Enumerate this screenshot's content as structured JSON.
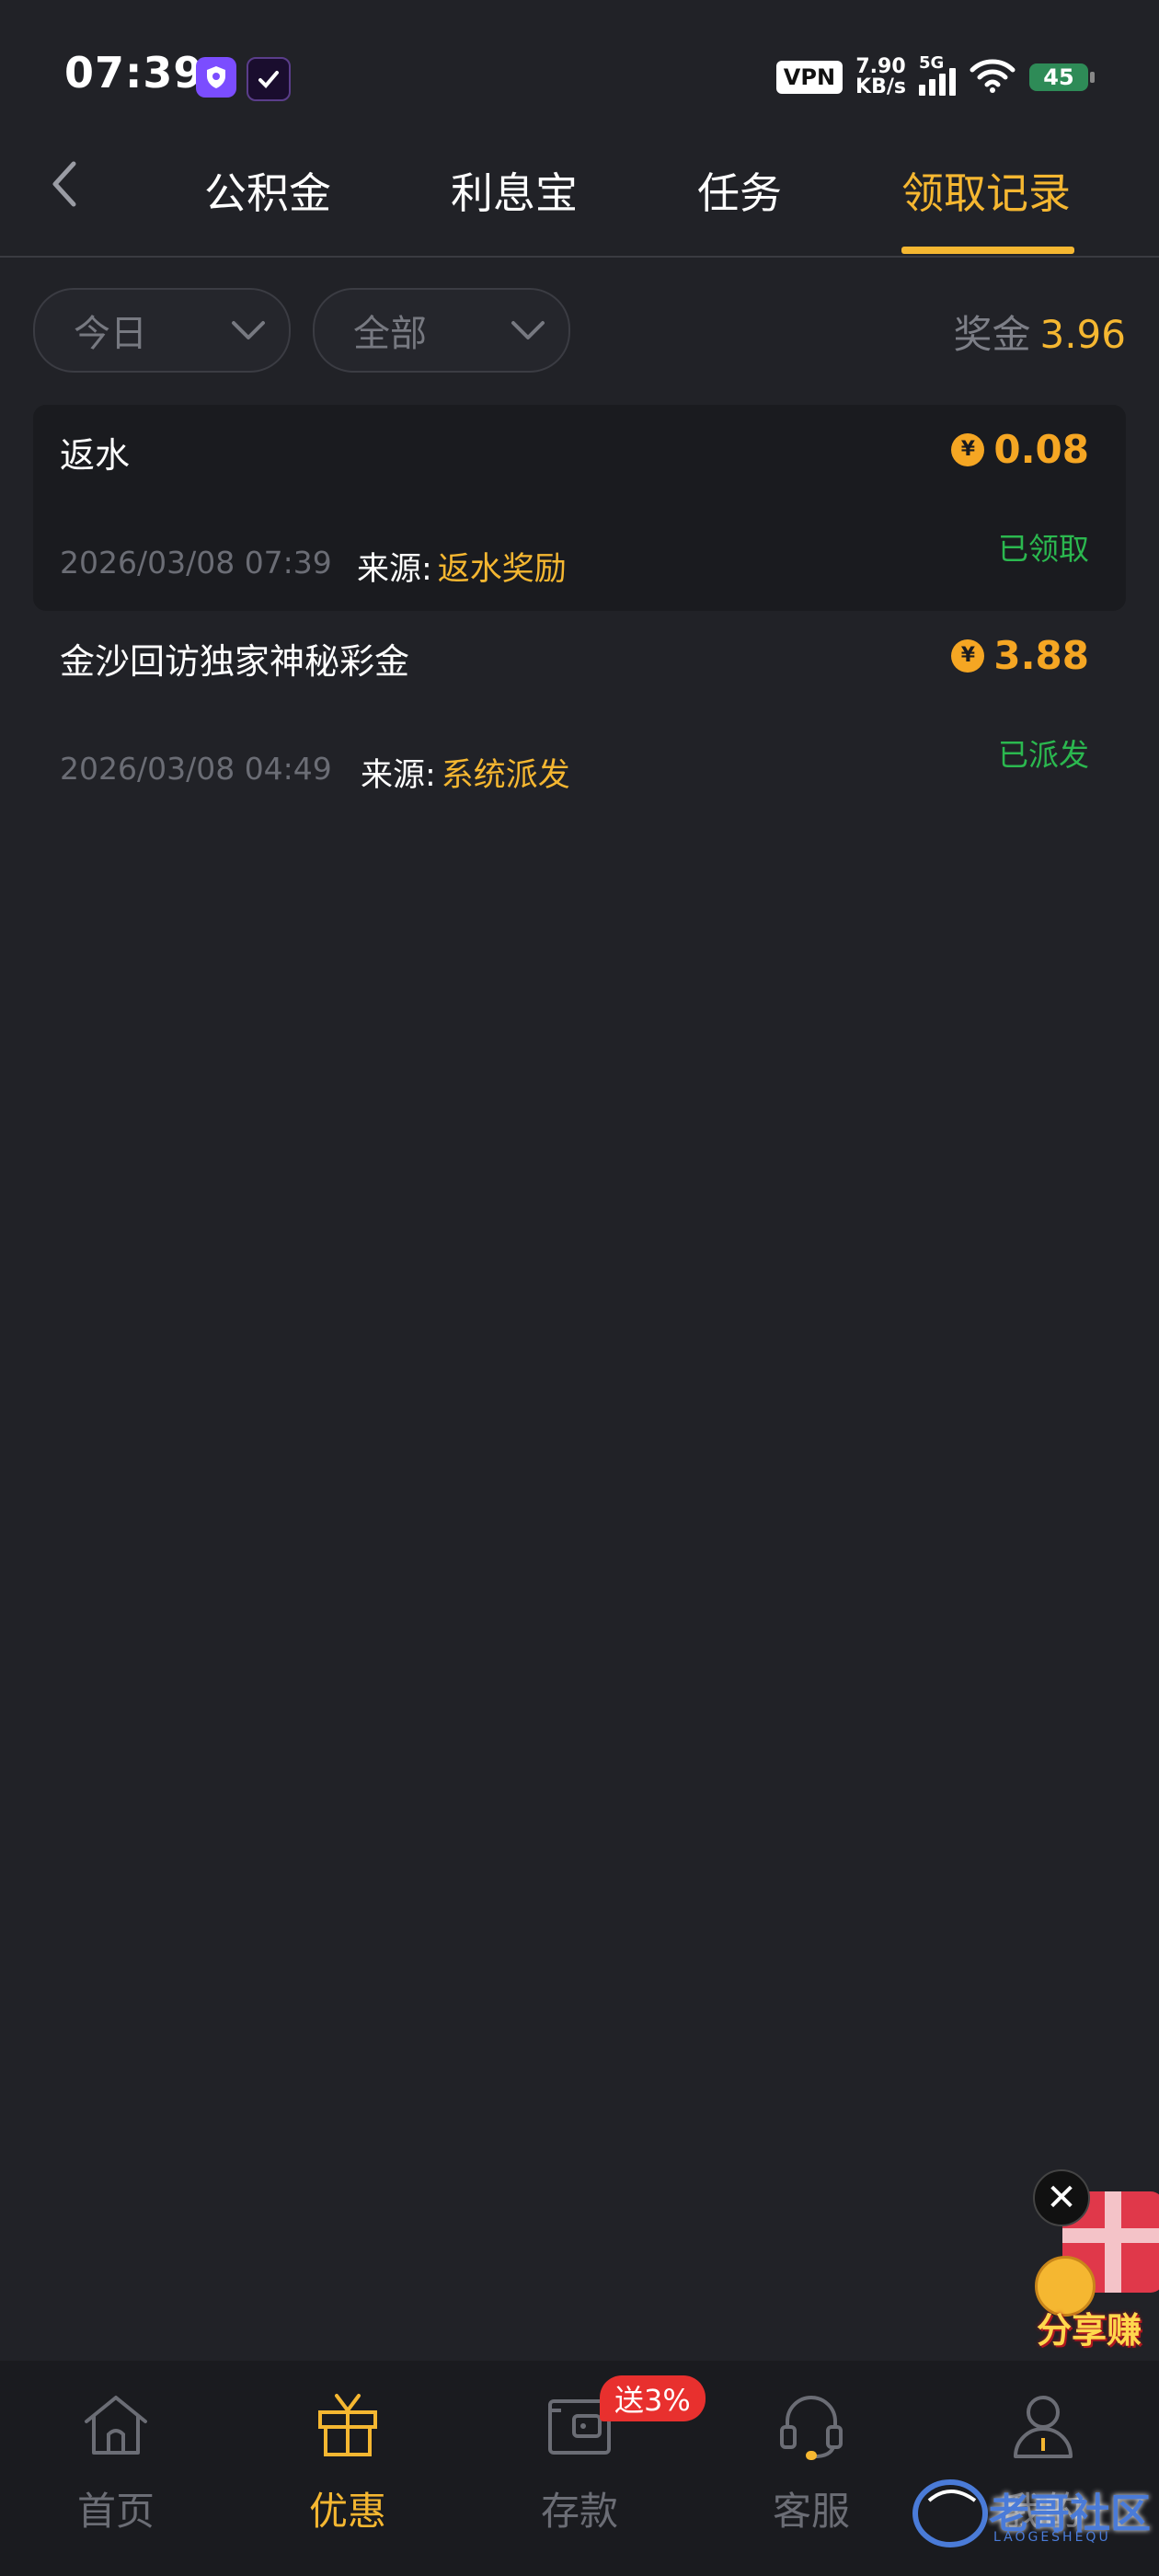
{
  "status_bar": {
    "time": "07:39",
    "vpn": "VPN",
    "speed_value": "7.90",
    "speed_unit": "KB/s",
    "network": "5G",
    "battery": "45"
  },
  "nav": {
    "tabs": [
      "公积金",
      "利息宝",
      "任务",
      "领取记录"
    ],
    "active_tab": 3
  },
  "filters": {
    "period": "今日",
    "category": "全部"
  },
  "bonus": {
    "label": "奖金",
    "value": "3.96"
  },
  "records": [
    {
      "title": "返水",
      "currency_symbol": "¥",
      "amount": "0.08",
      "time": "2026/03/08 07:39",
      "source_label": "来源:",
      "source_value": "返水奖励",
      "status": "已领取"
    },
    {
      "title": "金沙回访独家神秘彩金",
      "currency_symbol": "¥",
      "amount": "3.88",
      "time": "2026/03/08 04:49",
      "source_label": "来源:",
      "source_value": "系统派发",
      "status": "已派发"
    }
  ],
  "promo": {
    "close_glyph": "✕",
    "text": "分享赚"
  },
  "bottom_nav": {
    "items": [
      {
        "label": "首页",
        "icon": "home-icon"
      },
      {
        "label": "优惠",
        "icon": "gift-icon"
      },
      {
        "label": "存款",
        "icon": "wallet-icon"
      },
      {
        "label": "客服",
        "icon": "headset-icon"
      },
      {
        "label": "我的",
        "icon": "user-icon"
      }
    ],
    "active": 1,
    "deposit_badge": "送3%"
  },
  "watermark": {
    "text": "老哥社区",
    "sub": "LAOGESHEQU"
  },
  "colors": {
    "background": "#212227",
    "accent": "#f5b731",
    "amount": "#f5a623",
    "success": "#2bb84f",
    "badge": "#e8302e"
  }
}
